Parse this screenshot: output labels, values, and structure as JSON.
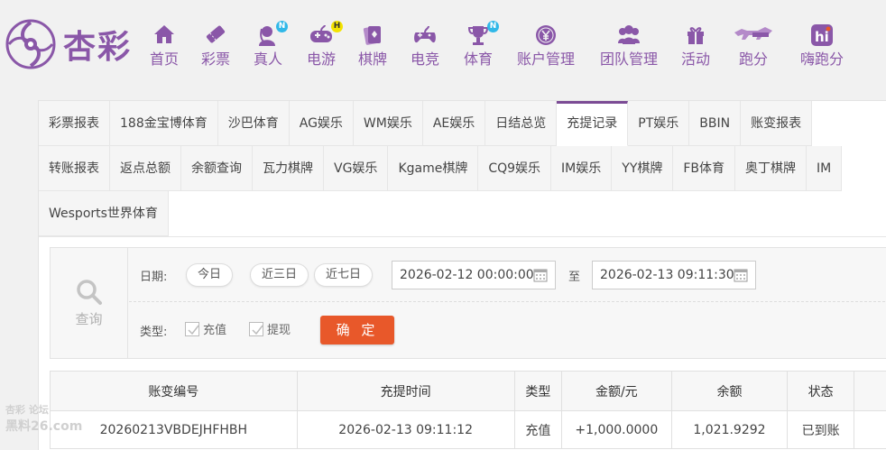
{
  "brand": {
    "name": "杏彩",
    "color": "#8a57a8"
  },
  "nav": [
    {
      "label": "首页",
      "icon": "home-icon"
    },
    {
      "label": "彩票",
      "icon": "ticket-icon"
    },
    {
      "label": "真人",
      "icon": "live-dealer-icon",
      "badge": "N"
    },
    {
      "label": "电游",
      "icon": "gamepad-icon",
      "badge": "H"
    },
    {
      "label": "棋牌",
      "icon": "cards-icon"
    },
    {
      "label": "电竞",
      "icon": "controller-icon"
    },
    {
      "label": "体育",
      "icon": "trophy-icon",
      "badge": "N"
    },
    {
      "label": "账户管理",
      "icon": "yen-coin-icon"
    },
    {
      "label": "团队管理",
      "icon": "team-icon"
    },
    {
      "label": "活动",
      "icon": "gift-icon"
    },
    {
      "label": "跑分",
      "icon": "running-dog-icon"
    },
    {
      "label": "嗨跑分",
      "icon": "hi-app-icon"
    }
  ],
  "tabs": {
    "row1": [
      "彩票报表",
      "188金宝博体育",
      "沙巴体育",
      "AG娱乐",
      "WM娱乐",
      "AE娱乐",
      "日结总览",
      "充提记录",
      "PT娱乐",
      "BBIN",
      "账变报表"
    ],
    "row2": [
      "转账报表",
      "返点总额",
      "余额查询",
      "瓦力棋牌",
      "VG娱乐",
      "Kgame棋牌",
      "CQ9娱乐",
      "IM娱乐",
      "YY棋牌",
      "FB体育",
      "奥丁棋牌",
      "IM"
    ],
    "row3": [
      "Wesports世界体育"
    ],
    "active": "充提记录"
  },
  "filter": {
    "search_label": "查询",
    "date_label": "日期:",
    "quick_ranges": [
      "今日",
      "近三日",
      "近七日"
    ],
    "date_from": "2026-02-12 00:00:00",
    "date_to_sep": "至",
    "date_to": "2026-02-13 09:11:30",
    "type_label": "类型:",
    "types": [
      "充值",
      "提现"
    ],
    "confirm_label": "确 定"
  },
  "table": {
    "headers": [
      "账变编号",
      "充提时间",
      "类型",
      "金额/元",
      "余额",
      "状态"
    ],
    "rows": [
      [
        "20260213VBDEJHFHBH",
        "2026-02-13 09:11:12",
        "充值",
        "+1,000.0000",
        "1,021.9292",
        "已到账"
      ]
    ]
  },
  "watermark": {
    "line1": "杏彩  论坛",
    "line2": "黑料26.com"
  },
  "colors": {
    "accent": "#7b4b95",
    "confirm": "#e8582a",
    "amount": "#e53935",
    "status_ok": "#31a02d"
  }
}
